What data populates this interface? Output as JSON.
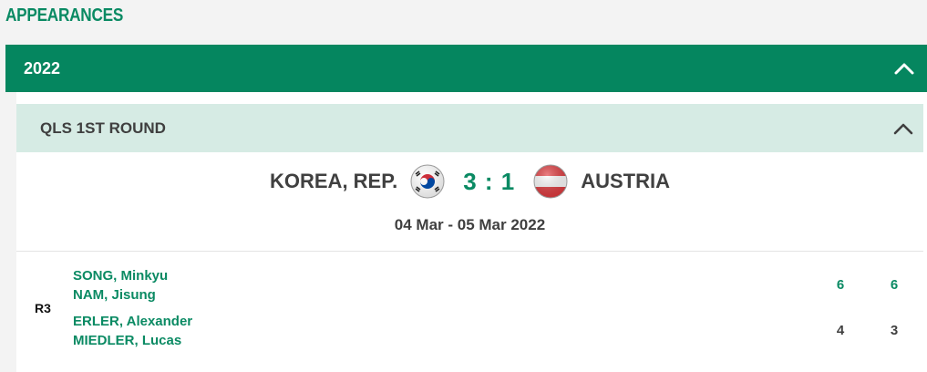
{
  "section": {
    "title": "APPEARANCES"
  },
  "year_group": {
    "label": "2022",
    "chevron_icon": "chevron-up-icon"
  },
  "round": {
    "label": "QLS 1ST ROUND",
    "chevron_icon": "chevron-up-icon"
  },
  "tie": {
    "home_team": "KOREA, REP.",
    "home_flag_icon": "korea-flag-icon",
    "score": "3 : 1",
    "away_flag_icon": "austria-flag-icon",
    "away_team": "AUSTRIA",
    "date": "04 Mar - 05 Mar 2022"
  },
  "rubber": {
    "label": "R3",
    "home_players": [
      "SONG, Minkyu",
      "NAM, Jisung"
    ],
    "away_players": [
      "ERLER, Alexander",
      "MIEDLER, Lucas"
    ],
    "home_set_scores": [
      "6",
      "6"
    ],
    "away_set_scores": [
      "4",
      "3"
    ]
  },
  "colors": {
    "brand_green": "#05865f",
    "light_green": "#d6ebe4",
    "text_green": "#0a8a63",
    "text_dark": "#404040"
  }
}
